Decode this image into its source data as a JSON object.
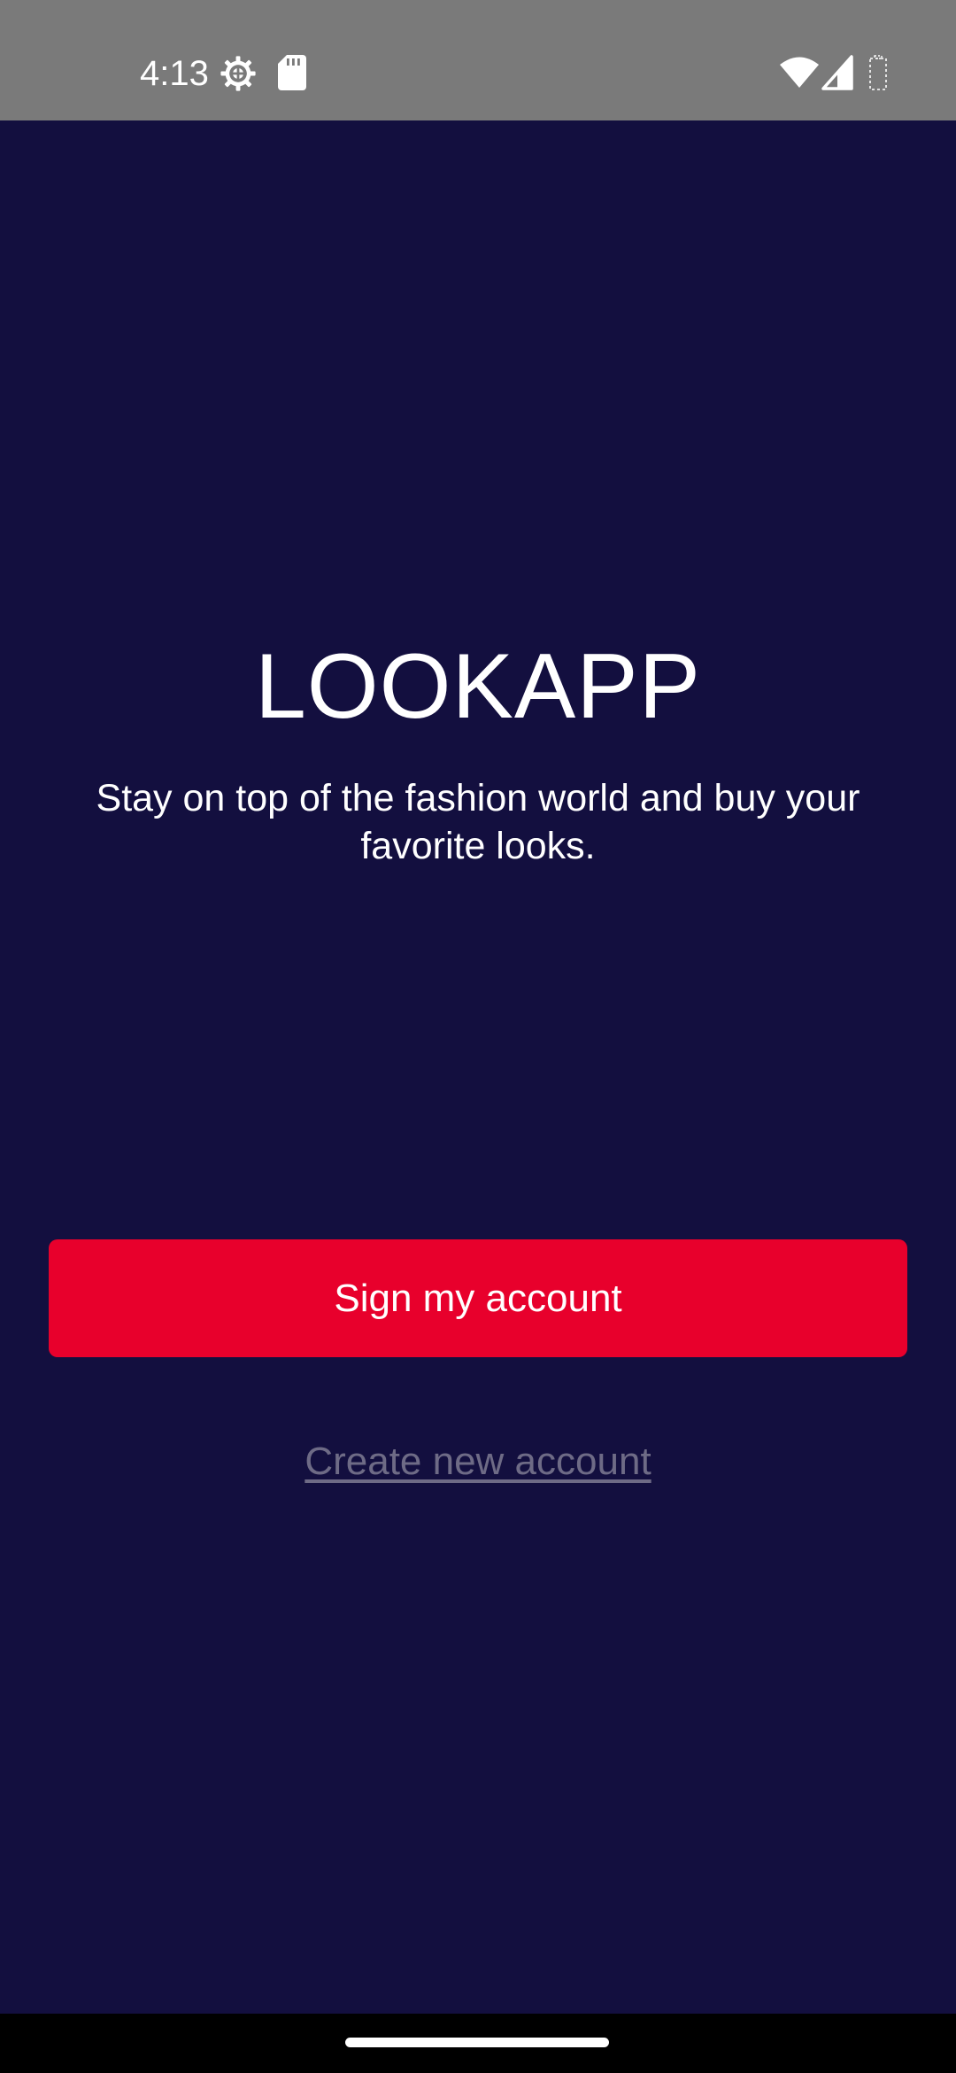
{
  "status_bar": {
    "time": "4:13",
    "icons": [
      "gear-icon",
      "sd-card-icon",
      "wifi-icon",
      "signal-icon",
      "battery-icon"
    ],
    "background": "#7a7a7a"
  },
  "app": {
    "title": "LOOKAPP",
    "tagline": "Stay on top of the fashion world and buy your favorite looks.",
    "background": "#130f3f"
  },
  "actions": {
    "sign_in_label": "Sign my account",
    "sign_in_color": "#e8002c",
    "create_account_label": "Create new account"
  }
}
